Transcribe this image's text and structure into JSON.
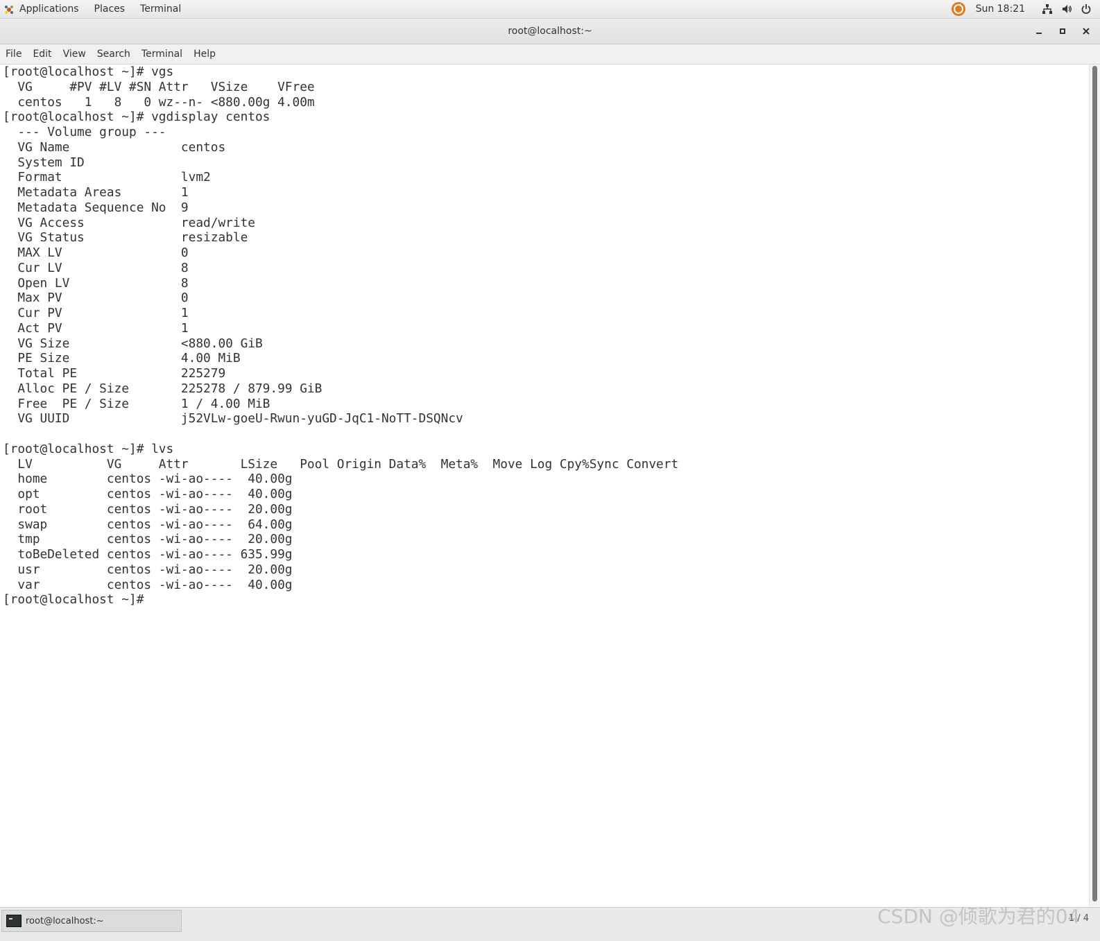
{
  "top_panel": {
    "applications": "Applications",
    "places": "Places",
    "terminal": "Terminal",
    "clock": "Sun 18:21",
    "icons": [
      "update-icon",
      "network-icon",
      "volume-icon",
      "power-icon"
    ]
  },
  "window": {
    "title": "root@localhost:~"
  },
  "menu": [
    "File",
    "Edit",
    "View",
    "Search",
    "Terminal",
    "Help"
  ],
  "terminal_lines": [
    "[root@localhost ~]# vgs",
    "  VG     #PV #LV #SN Attr   VSize    VFree",
    "  centos   1   8   0 wz--n- <880.00g 4.00m",
    "[root@localhost ~]# vgdisplay centos",
    "  --- Volume group ---",
    "  VG Name               centos",
    "  System ID",
    "  Format                lvm2",
    "  Metadata Areas        1",
    "  Metadata Sequence No  9",
    "  VG Access             read/write",
    "  VG Status             resizable",
    "  MAX LV                0",
    "  Cur LV                8",
    "  Open LV               8",
    "  Max PV                0",
    "  Cur PV                1",
    "  Act PV                1",
    "  VG Size               <880.00 GiB",
    "  PE Size               4.00 MiB",
    "  Total PE              225279",
    "  Alloc PE / Size       225278 / 879.99 GiB",
    "  Free  PE / Size       1 / 4.00 MiB",
    "  VG UUID               j52VLw-goeU-Rwun-yuGD-JqC1-NoTT-DSQNcv",
    "",
    "[root@localhost ~]# lvs",
    "  LV          VG     Attr       LSize   Pool Origin Data%  Meta%  Move Log Cpy%Sync Convert",
    "  home        centos -wi-ao----  40.00g",
    "  opt         centos -wi-ao----  40.00g",
    "  root        centos -wi-ao----  20.00g",
    "  swap        centos -wi-ao----  64.00g",
    "  tmp         centos -wi-ao----  20.00g",
    "  toBeDeleted centos -wi-ao---- 635.99g",
    "  usr         centos -wi-ao----  20.00g",
    "  var         centos -wi-ao----  40.00g",
    "[root@localhost ~]# "
  ],
  "taskbar": {
    "item_label": "root@localhost:~",
    "pager": "1 / 4"
  },
  "watermark": "CSDN @倾歌为君的04"
}
